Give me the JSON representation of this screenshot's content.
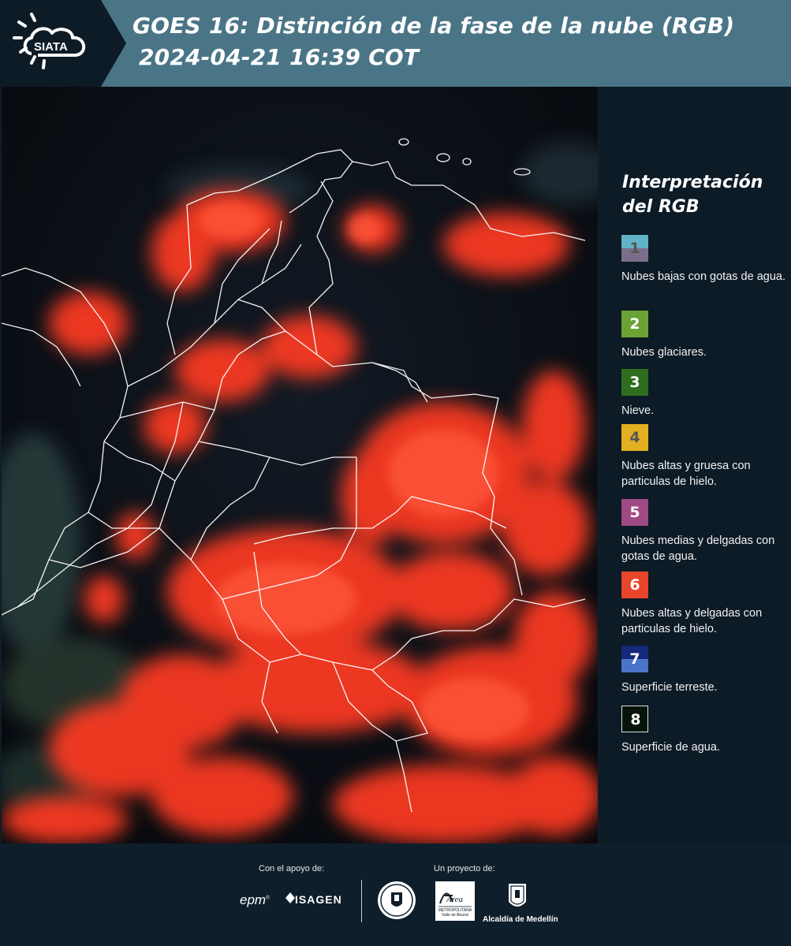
{
  "header": {
    "logo_text": "SIATA",
    "title_line1": "GOES 16: Distinción de la fase de la nube (RGB)",
    "title_line2": "2024-04-21 16:39 COT"
  },
  "colors": {
    "header_bg": "#4a7587",
    "panel_bg": "#0d1b26",
    "cloud_red": "#ff3b22",
    "map_dark": "#0b0f14",
    "border_white": "#ffffff"
  },
  "legend": {
    "title_line1": "Interpretación",
    "title_line2": "del RGB",
    "items": [
      {
        "number": "1",
        "label": "Nubes bajas con gotas de agua.",
        "color_top": "#5fb3c4",
        "color_bottom": "#7a6f8a",
        "num_color": "#555555"
      },
      {
        "number": "2",
        "label": "Nubes glaciares.",
        "color_top": "#6aa334",
        "color_bottom": "#6aa334",
        "num_color": "#ffffff"
      },
      {
        "number": "3",
        "label": "Nieve.",
        "color_top": "#2e6e1e",
        "color_bottom": "#2e6e1e",
        "num_color": "#ffffff"
      },
      {
        "number": "4",
        "label": "Nubes altas y gruesa con particulas de hielo.",
        "color_top": "#e2b021",
        "color_bottom": "#e2b021",
        "num_color": "#555555"
      },
      {
        "number": "5",
        "label": "Nubes medias y delgadas con gotas de agua.",
        "color_top": "#a04a85",
        "color_bottom": "#a04a85",
        "num_color": "#ffffff"
      },
      {
        "number": "6",
        "label": "Nubes altas y delgadas con particulas de hielo.",
        "color_top": "#e8452a",
        "color_bottom": "#e8452a",
        "num_color": "#ffffff"
      },
      {
        "number": "7",
        "label": "Superficie terreste.",
        "color_top": "#14297a",
        "color_bottom": "#4b74c9",
        "num_color": "#ffffff"
      },
      {
        "number": "8",
        "label": "Superficie de agua.",
        "color_top": "#06140a",
        "color_bottom": "#06140a",
        "num_color": "#ffffff"
      }
    ]
  },
  "footer": {
    "support_caption": "Con el apoyo de:",
    "project_caption": "Un proyecto de:",
    "sponsor_epm": "epm",
    "sponsor_isagen": "ISAGEN",
    "partner_amva": "METROPOLITANA Valle de Aburrá",
    "partner_alcaldia": "Alcaldía de Medellín",
    "logo_amva_script": "Área"
  }
}
